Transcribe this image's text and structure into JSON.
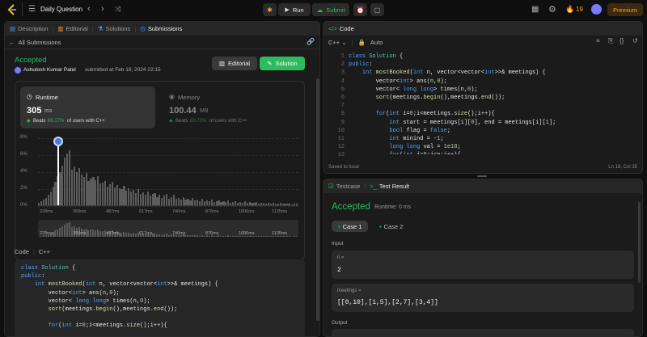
{
  "topbar": {
    "problem_list_label": "Daily Question",
    "run_label": "Run",
    "submit_label": "Submit",
    "streak_count": "19",
    "premium_label": "Premium"
  },
  "left_tabs": [
    "Description",
    "Editorial",
    "Solutions",
    "Submissions"
  ],
  "submissions": {
    "back_label": "All Submissions",
    "status": "Accepted",
    "author": "Ashutosh Kumar Patel",
    "submitted_text": "submitted at Feb 18, 2024 22:15",
    "editorial_btn": "Editorial",
    "solution_btn": "Solution",
    "runtime": {
      "label": "Runtime",
      "value": "305",
      "unit": "ms",
      "beats_prefix": "Beats",
      "beats_value": "86.17%",
      "beats_suffix": "of users with C++"
    },
    "memory": {
      "label": "Memory",
      "value": "100.44",
      "unit": "MB",
      "beats_prefix": "Beats",
      "beats_value": "80.75%",
      "beats_suffix": "of users with C++"
    },
    "code_label": "Code",
    "code_lang": "C++"
  },
  "chart_data": {
    "type": "bar",
    "title": "",
    "xlabel": "",
    "ylabel": "",
    "y_ticks": [
      "8%",
      "6%",
      "4%",
      "2%",
      "0%"
    ],
    "x_ticks": [
      "228ms",
      "358ms",
      "487ms",
      "617ms",
      "746ms",
      "876ms",
      "1006ms",
      "1135ms"
    ],
    "ylim": [
      0,
      8
    ],
    "highlighted_value_ms": 305,
    "values": [
      0.3,
      0.5,
      0.7,
      0.9,
      1.2,
      1.6,
      2.2,
      2.8,
      3.4,
      3.9,
      4.7,
      5.6,
      6.1,
      6.5,
      4.2,
      4.6,
      3.9,
      4.4,
      3.6,
      3.3,
      3.8,
      2.9,
      3.1,
      3.3,
      3.0,
      3.4,
      2.6,
      2.7,
      2.9,
      2.2,
      2.5,
      2.8,
      2.1,
      2.4,
      2.0,
      1.9,
      2.3,
      1.7,
      2.0,
      1.6,
      1.8,
      1.4,
      1.9,
      1.3,
      1.5,
      1.2,
      1.6,
      1.1,
      1.3,
      1.4,
      1.0,
      1.2,
      0.9,
      1.1,
      1.3,
      0.8,
      1.0,
      1.2,
      0.8,
      0.9,
      0.7,
      1.0,
      0.7,
      0.8,
      0.6,
      0.9,
      0.6,
      0.7,
      0.5,
      0.8,
      0.5,
      0.6,
      0.5,
      0.7,
      0.4,
      0.5,
      0.6,
      0.4,
      0.5,
      0.4,
      0.6,
      0.3,
      0.4,
      0.5,
      0.3,
      0.4,
      0.3,
      0.5,
      0.3,
      0.4,
      0.3,
      0.3,
      0.4,
      0.2,
      0.3,
      0.3,
      0.2,
      0.3,
      0.2,
      0.3,
      0.2,
      0.2,
      0.3,
      0.2,
      0.2,
      0.2,
      0.2,
      0.1,
      0.2,
      0.2
    ]
  },
  "code_lines": [
    [
      [
        "kw",
        "class "
      ],
      [
        "ty",
        "Solution "
      ],
      [
        "pl",
        "{"
      ]
    ],
    [
      [
        "kw",
        "public"
      ],
      [
        "pl",
        ":"
      ]
    ],
    [
      [
        "pl",
        "    "
      ],
      [
        "kw",
        "int "
      ],
      [
        "fn",
        "mostBooked"
      ],
      [
        "pl",
        "("
      ],
      [
        "kw",
        "int "
      ],
      [
        "pl",
        "n, vector<vector<"
      ],
      [
        "kw",
        "int"
      ],
      [
        "pl",
        ">>& meetings) {"
      ]
    ],
    [
      [
        "pl",
        "        vector<"
      ],
      [
        "kw",
        "int"
      ],
      [
        "pl",
        "> ans(n,"
      ],
      [
        "nm",
        "0"
      ],
      [
        "pl",
        ");"
      ]
    ],
    [
      [
        "pl",
        "        vector< "
      ],
      [
        "kw",
        "long long"
      ],
      [
        "pl",
        "> times(n,"
      ],
      [
        "nm",
        "0"
      ],
      [
        "pl",
        ");"
      ]
    ],
    [
      [
        "pl",
        "        "
      ],
      [
        "fn",
        "sort"
      ],
      [
        "pl",
        "(meetings."
      ],
      [
        "fn",
        "begin"
      ],
      [
        "pl",
        "(),meetings."
      ],
      [
        "fn",
        "end"
      ],
      [
        "pl",
        "());"
      ]
    ],
    [
      [
        "pl",
        ""
      ]
    ],
    [
      [
        "pl",
        "        "
      ],
      [
        "kw",
        "for"
      ],
      [
        "pl",
        "("
      ],
      [
        "kw",
        "int "
      ],
      [
        "pl",
        "i="
      ],
      [
        "nm",
        "0"
      ],
      [
        "pl",
        ";i<meetings."
      ],
      [
        "fn",
        "size"
      ],
      [
        "pl",
        "();i++){"
      ]
    ],
    [
      [
        "pl",
        "            "
      ],
      [
        "kw",
        "int "
      ],
      [
        "pl",
        "start = meetings[i]["
      ],
      [
        "nm",
        "0"
      ],
      [
        "pl",
        "], end = meetings[i]["
      ],
      [
        "nm",
        "1"
      ],
      [
        "pl",
        "];"
      ]
    ],
    [
      [
        "pl",
        "            "
      ],
      [
        "kw",
        "bool "
      ],
      [
        "pl",
        "flag = "
      ],
      [
        "kw",
        "false"
      ],
      [
        "pl",
        ";"
      ]
    ],
    [
      [
        "pl",
        "            "
      ],
      [
        "kw",
        "int "
      ],
      [
        "pl",
        "minind = -"
      ],
      [
        "nm",
        "1"
      ],
      [
        "pl",
        ";"
      ]
    ],
    [
      [
        "pl",
        "            "
      ],
      [
        "kw",
        "long long "
      ],
      [
        "pl",
        "val = "
      ],
      [
        "nm",
        "1e18"
      ],
      [
        "pl",
        ";"
      ]
    ],
    [
      [
        "pl",
        "            "
      ],
      [
        "kw",
        "for"
      ],
      [
        "pl",
        "("
      ],
      [
        "kw",
        "int "
      ],
      [
        "pl",
        "j="
      ],
      [
        "nm",
        "0"
      ],
      [
        "pl",
        ";j<n;j++){"
      ]
    ]
  ],
  "editor": {
    "title": "Code",
    "lang": "C++",
    "auto_label": "Auto",
    "saved_label": "Saved to local",
    "cursor_pos": "Ln 18, Col 35"
  },
  "result": {
    "testcase_tab": "Testcase",
    "result_tab": "Test Result",
    "status": "Accepted",
    "runtime_text": "Runtime: 0 ms",
    "case1": "Case 1",
    "case2": "Case 2",
    "input_label": "Input",
    "n_label": "n =",
    "n_value": "2",
    "meetings_label": "meetings =",
    "meetings_value": "[[0,10],[1,5],[2,7],[3,4]]",
    "output_label": "Output"
  },
  "colors": {
    "accent_green": "#2cbb5d",
    "orange": "#ffa116",
    "blue_kw": "#4fa3ff"
  }
}
